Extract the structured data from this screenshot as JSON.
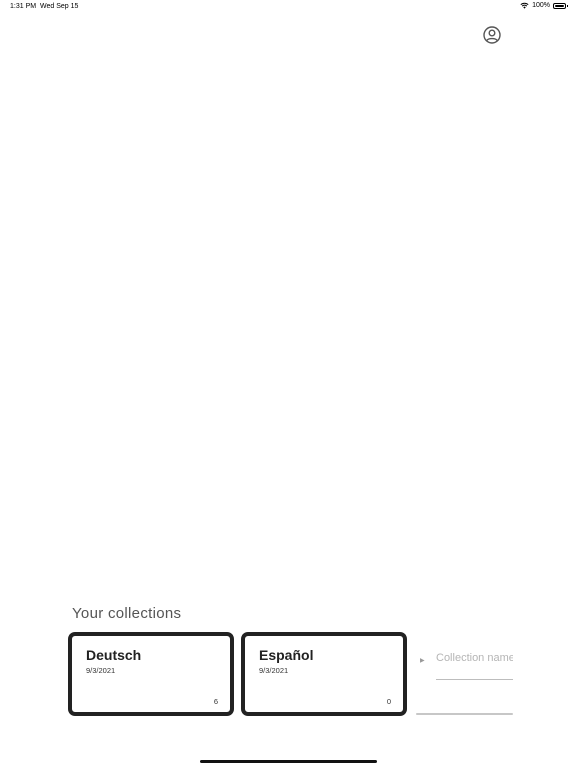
{
  "status_bar": {
    "time": "1:31 PM",
    "date": "Wed Sep 15",
    "battery": "100%",
    "icons": [
      "wifi-icon",
      "battery-icon"
    ]
  },
  "header": {
    "profile_icon": "person-circle-icon"
  },
  "collections": {
    "title": "Your collections",
    "items": [
      {
        "name": "Deutsch",
        "date": "9/3/2021",
        "count": "6"
      },
      {
        "name": "Español",
        "date": "9/3/2021",
        "count": "0"
      }
    ],
    "new_collection": {
      "placeholder": "Collection name",
      "value": "",
      "chevron_icon": "caret-right-icon"
    }
  },
  "colors": {
    "card_border": "#222222",
    "text_muted": "#555555",
    "background": "#ffffff"
  }
}
